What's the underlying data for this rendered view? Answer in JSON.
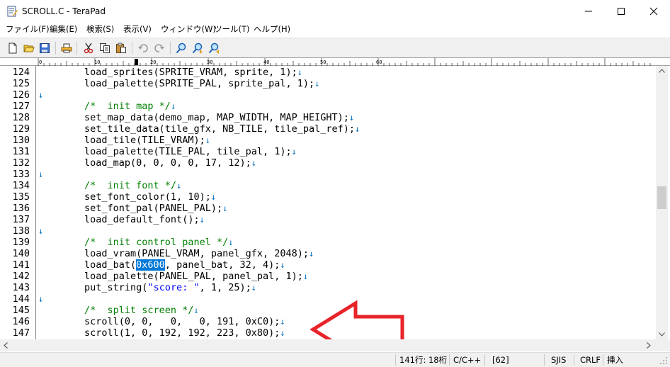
{
  "window": {
    "title": "SCROLL.C - TeraPad",
    "minimize_glyph": "—",
    "maximize_glyph": "☐",
    "close_glyph": "✕"
  },
  "menu": [
    {
      "label": "ファイル(F)"
    },
    {
      "label": "編集(E)"
    },
    {
      "label": "検索(S)"
    },
    {
      "label": "表示(V)"
    },
    {
      "label": "ウィンドウ(W)"
    },
    {
      "label": "ツール(T)"
    },
    {
      "label": "ヘルプ(H)"
    }
  ],
  "toolbar": {
    "icons": [
      "new-file-icon",
      "open-folder-icon",
      "save-icon",
      "print-icon",
      "cut-icon",
      "copy-icon",
      "paste-icon",
      "undo-icon",
      "redo-icon",
      "find-icon",
      "find-next-icon",
      "find-previous-icon"
    ]
  },
  "ruler": {
    "labels": [
      "0",
      "10",
      "20",
      "30",
      "40",
      "50",
      "60"
    ]
  },
  "editor": {
    "newline_mark": "↓",
    "lines": [
      {
        "n": "124",
        "text": "        load_sprites(SPRITE_VRAM, sprite, 1);"
      },
      {
        "n": "125",
        "text": "        load_palette(SPRITE_PAL, sprite_pal, 1);"
      },
      {
        "n": "126",
        "text": ""
      },
      {
        "n": "127",
        "text": "        /*  init map */"
      },
      {
        "n": "128",
        "text": "        set_map_data(demo_map, MAP_WIDTH, MAP_HEIGHT);"
      },
      {
        "n": "129",
        "text": "        set_tile_data(tile_gfx, NB_TILE, tile_pal_ref);"
      },
      {
        "n": "130",
        "text": "        load_tile(TILE_VRAM);"
      },
      {
        "n": "131",
        "text": "        load_palette(TILE_PAL, tile_pal, 1);"
      },
      {
        "n": "132",
        "text": "        load_map(0, 0, 0, 0, 17, 12);"
      },
      {
        "n": "133",
        "text": ""
      },
      {
        "n": "134",
        "text": "        /*  init font */"
      },
      {
        "n": "135",
        "text": "        set_font_color(1, 10);"
      },
      {
        "n": "136",
        "text": "        set_font_pal(PANEL_PAL);"
      },
      {
        "n": "137",
        "text": "        load_default_font();"
      },
      {
        "n": "138",
        "text": ""
      },
      {
        "n": "139",
        "text": "        /*  init control panel */"
      },
      {
        "n": "140",
        "text": "        load_vram(PANEL_VRAM, panel_gfx, 2048);"
      },
      {
        "n": "141",
        "text_before": "        load_bat(",
        "selected": "0x600",
        "text_after": ", panel_bat, 32, 4);"
      },
      {
        "n": "142",
        "text": "        load_palette(PANEL_PAL, panel_pal, 1);"
      },
      {
        "n": "143",
        "text_before": "        put_string(",
        "string": "\"score: \"",
        "text_after": ", 1, 25);"
      },
      {
        "n": "144",
        "text": ""
      },
      {
        "n": "145",
        "text": "        /*  split screen */"
      },
      {
        "n": "146",
        "text": "        scroll(0, 0,   0,   0, 191, 0xC0);"
      },
      {
        "n": "147",
        "text": "        scroll(1, 0, 192, 192, 223, 0x80);"
      }
    ]
  },
  "status": {
    "position": "141行:  18桁",
    "language": "C/C++",
    "char_code": "[62]",
    "encoding": "SJIS",
    "line_ending": "CRLF",
    "mode": "挿入"
  },
  "colors": {
    "comment": "#008000",
    "newline_mark": "#0070c0",
    "selection": "#0078d7",
    "annotation_arrow": "#e8232a"
  }
}
